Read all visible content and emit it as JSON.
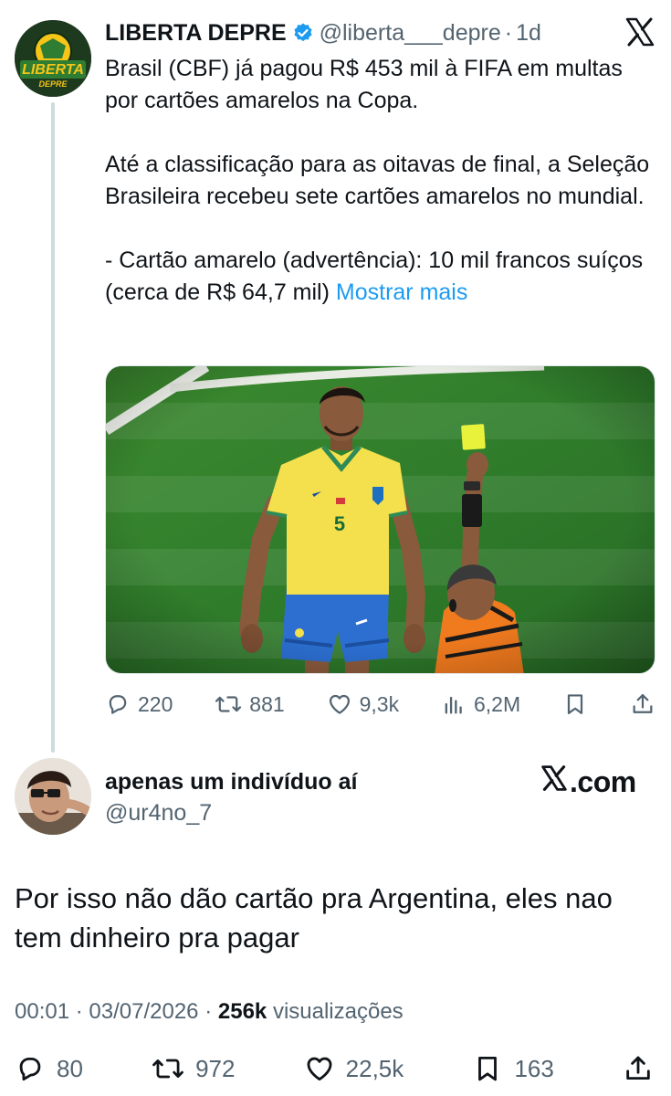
{
  "quoted_tweet": {
    "author_name": "LIBERTA DEPRE",
    "handle": "@liberta___depre",
    "separator": "·",
    "time": "1d",
    "avatar_text_top": "LIBERTA",
    "avatar_text_bottom": "DEPRE",
    "paragraphs": [
      "Brasil (CBF) já pagou R$ 453 mil à FIFA em multas por cartões amarelos na Copa.",
      "Até a classificação para as oitavas de final, a Seleção Brasileira recebeu sete cartões amarelos no mundial.",
      "- Cartão amarelo (advertência): 10 mil francos suíços (cerca de R$ 64,7 mil)"
    ],
    "show_more": "Mostrar mais",
    "jersey_number": "5",
    "stats": {
      "replies": "220",
      "retweets": "881",
      "likes": "9,3k",
      "views": "6,2M"
    }
  },
  "reply_tweet": {
    "author_name": "apenas um indivíduo aí",
    "handle": "@ur4no_7",
    "brand": ".com",
    "text": "Por isso não dão cartão pra Argentina, eles nao tem dinheiro pra pagar",
    "time": "00:01",
    "date": "03/07/2026",
    "views_count": "256k",
    "views_label": "visualizações",
    "stats": {
      "replies": "80",
      "retweets": "972",
      "likes": "22,5k",
      "bookmarks": "163"
    }
  },
  "colors": {
    "text": "#0f1419",
    "secondary": "#536471",
    "link": "#1d9bf0",
    "verified": "#1d9bf0",
    "pitch": "#2f7d2b",
    "jersey": "#f4e04d",
    "shorts": "#2c6fd1",
    "yellow_card": "#e8f23a",
    "referee_shirt": "#f07a1e"
  }
}
